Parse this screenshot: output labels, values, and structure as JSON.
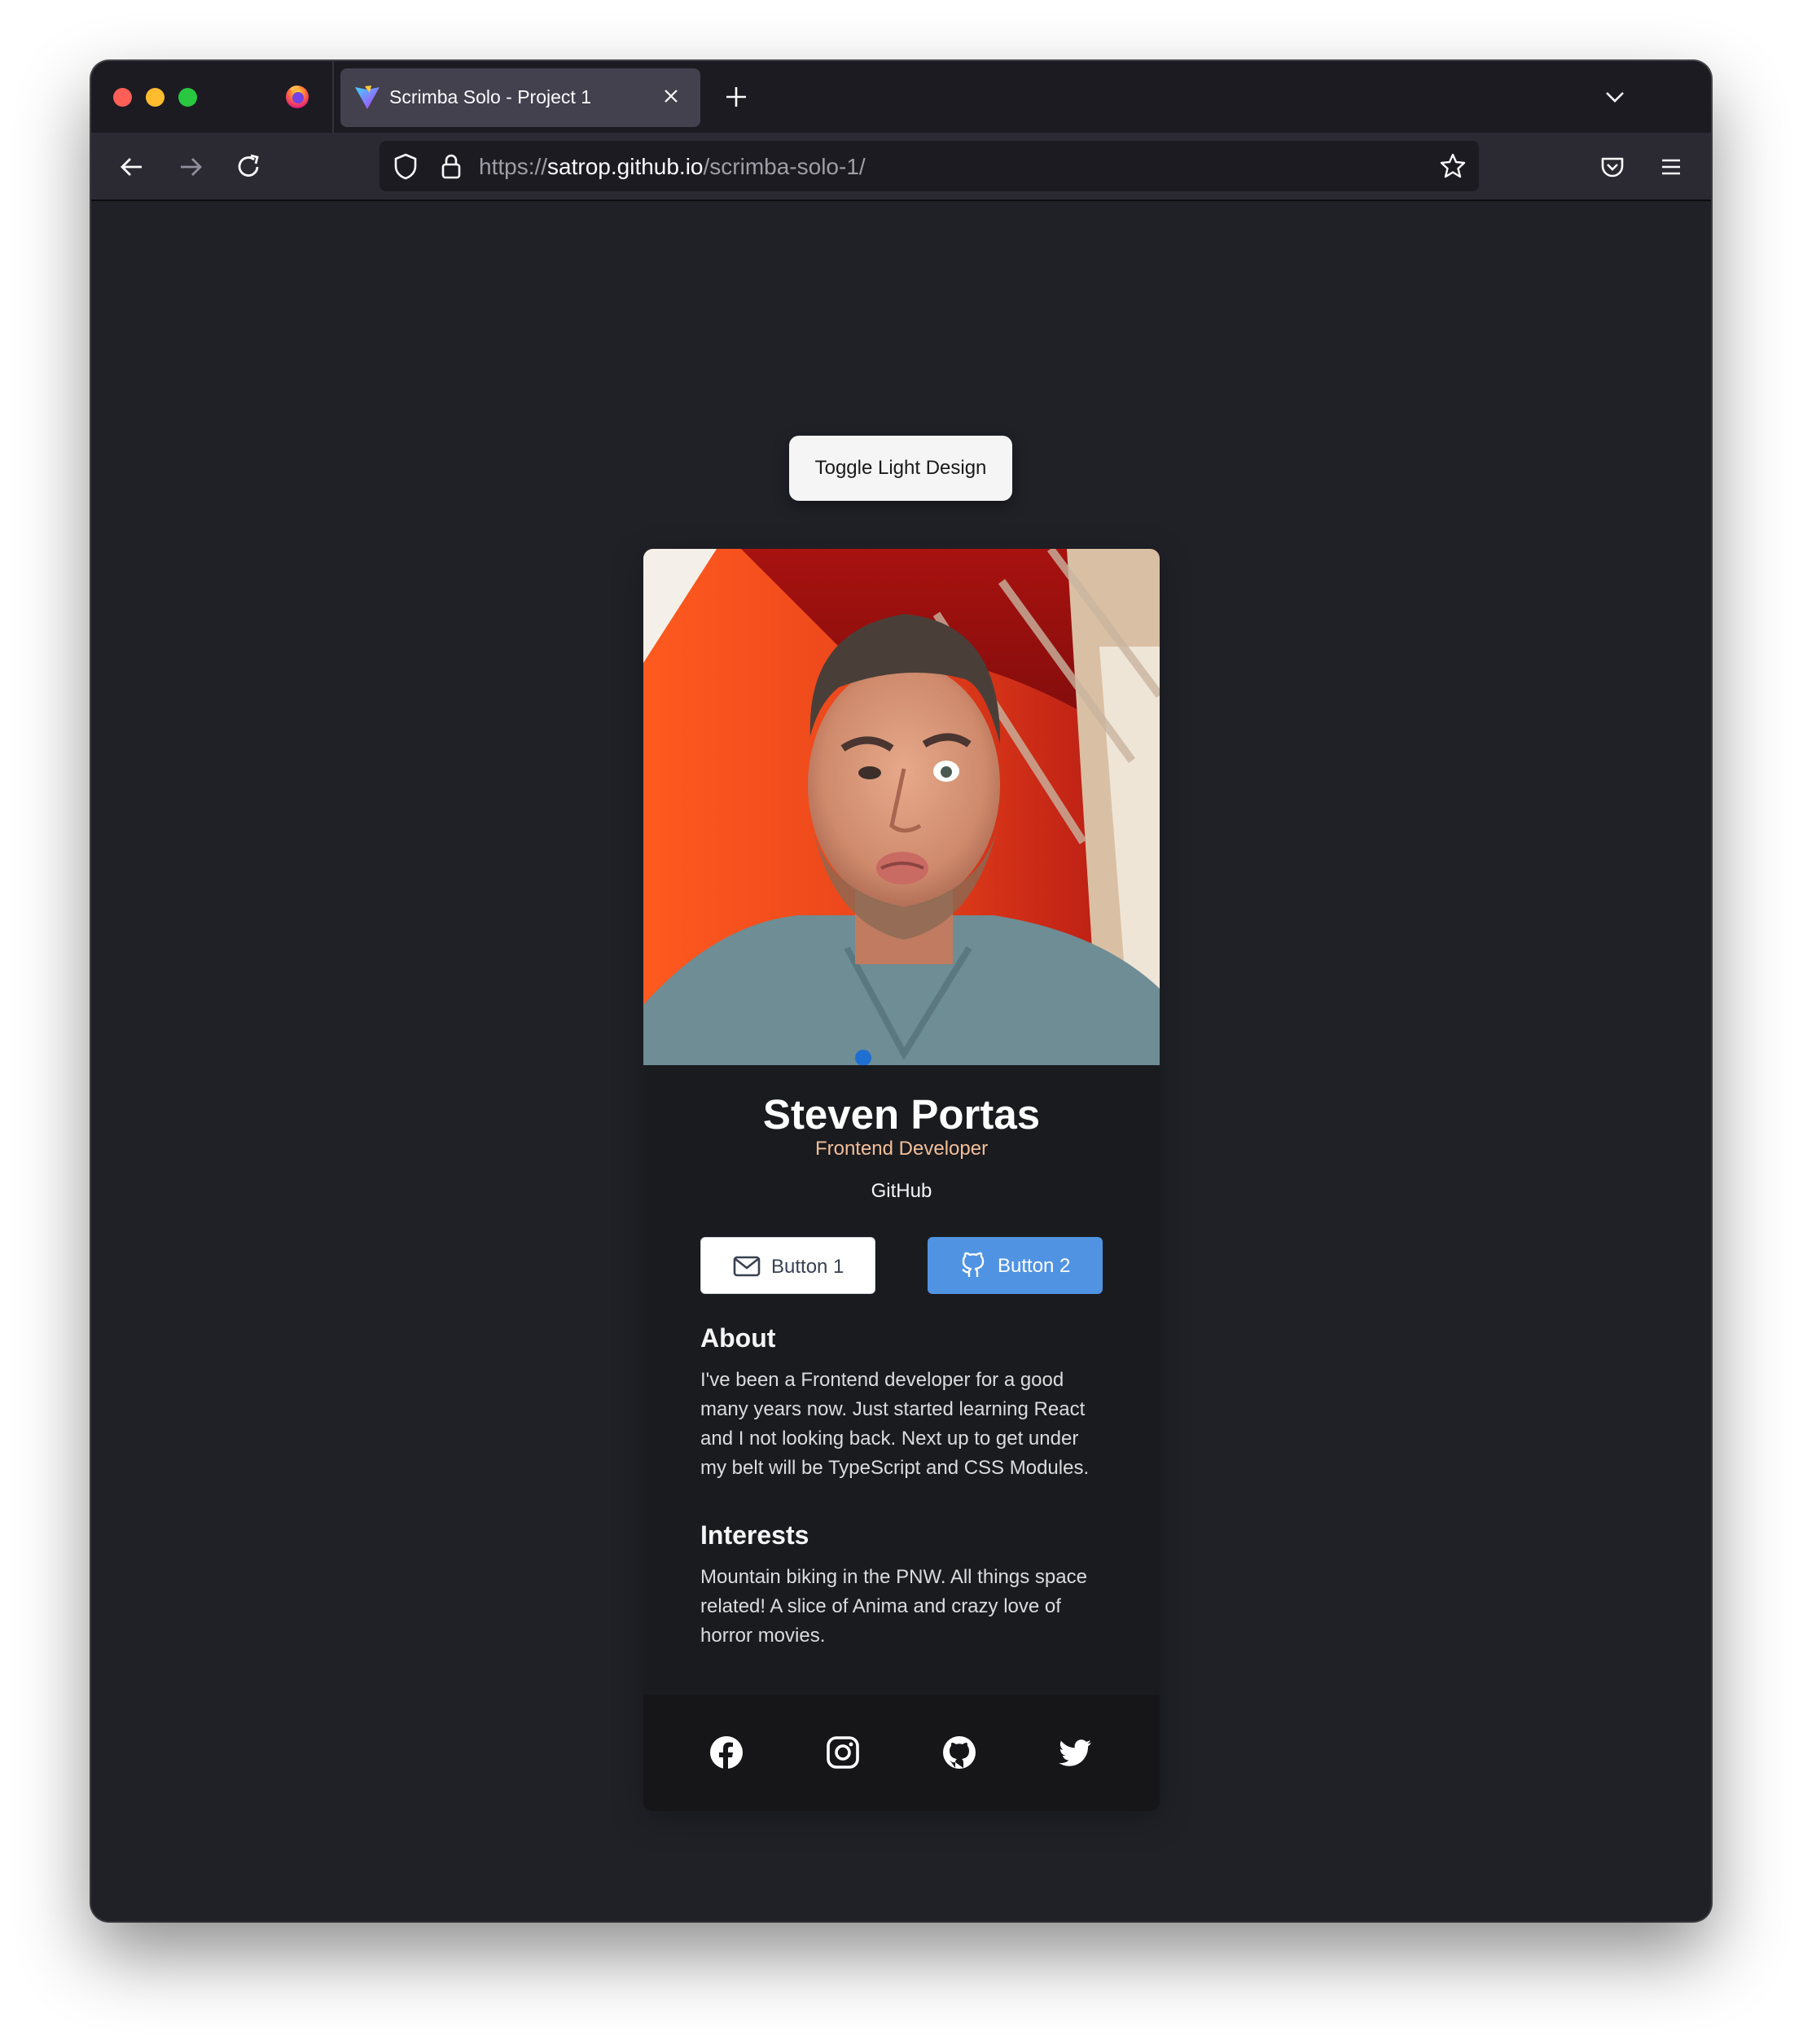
{
  "browser": {
    "tab_title": "Scrimba Solo - Project 1",
    "url_scheme": "https://",
    "url_domain": "satrop.github.io",
    "url_path": "/scrimba-solo-1/"
  },
  "page": {
    "toggle_label": "Toggle Light Design",
    "profile": {
      "name": "Steven Portas",
      "role": "Frontend Developer",
      "link_label": "GitHub",
      "role_color": "#f3bf99"
    },
    "buttons": {
      "button1_label": "Button 1",
      "button1_icon": "mail-icon",
      "button2_label": "Button 2",
      "button2_icon": "github-icon",
      "button2_color": "#5093e2"
    },
    "about": {
      "title": "About",
      "text": "I've been a Frontend developer for a good many years now. Just started learning React and I not looking back. Next up to get under my belt will be TypeScript and CSS Modules."
    },
    "interests": {
      "title": "Interests",
      "text": "Mountain biking in the PNW. All things space related! A slice of Anima and crazy love of horror movies."
    },
    "social_icons": [
      "facebook-icon",
      "instagram-icon",
      "github-icon",
      "twitter-icon"
    ]
  }
}
